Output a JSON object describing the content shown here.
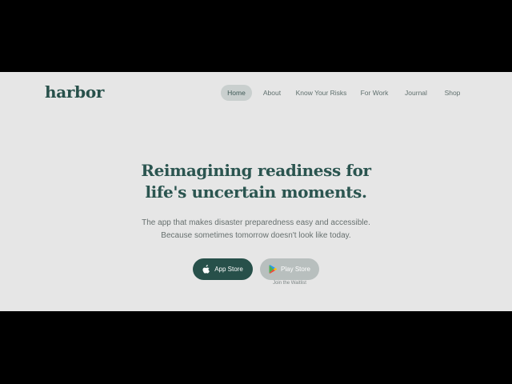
{
  "brand": {
    "name": "harbor"
  },
  "nav": {
    "items": [
      {
        "label": "Home",
        "active": true
      },
      {
        "label": "About",
        "active": false
      },
      {
        "label": "Know Your Risks",
        "active": false
      },
      {
        "label": "For Work",
        "active": false
      },
      {
        "label": "Journal",
        "active": false
      },
      {
        "label": "Shop",
        "active": false
      }
    ]
  },
  "hero": {
    "headline_line1": "Reimagining readiness for",
    "headline_line2": "life's uncertain moments.",
    "sub_line1": "The app that makes disaster preparedness easy and accessible.",
    "sub_line2": "Because sometimes tomorrow doesn't look like today."
  },
  "cta": {
    "app_store_label": "App Store",
    "play_store_label": "Play Store",
    "waitlist_note": "Join the Waitlist",
    "app_store_icon": "apple-icon",
    "play_store_icon": "google-play-icon"
  },
  "colors": {
    "brand": "#27504a",
    "background": "#e6e6e6",
    "nav_active_bg": "#c9cfce",
    "play_button_bg": "#b8bfbe"
  }
}
